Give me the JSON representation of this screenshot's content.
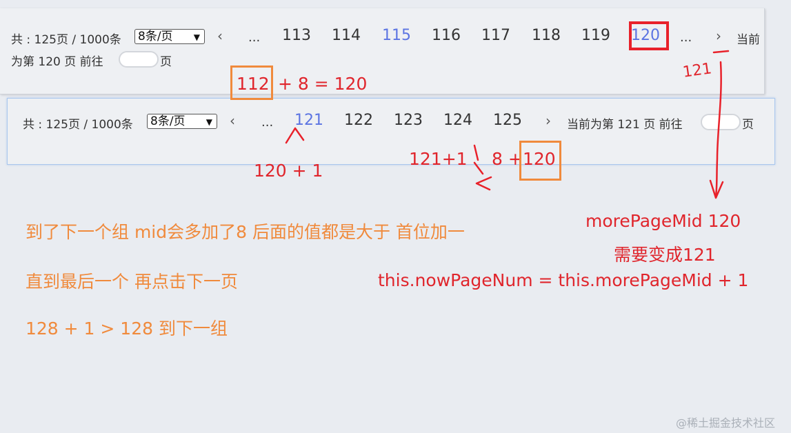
{
  "pager_top": {
    "total": "共 : 125页 / 1000条",
    "page_size": "8条/页",
    "prev": "‹",
    "ellipsis_left": "...",
    "pages": [
      "113",
      "114",
      "115",
      "116",
      "117",
      "118",
      "119",
      "120"
    ],
    "ellipsis_right": "...",
    "next": "›",
    "current_line1": "当前",
    "current_line2": "为第 120 页 前往",
    "page_suffix": "页"
  },
  "pager_bottom": {
    "total": "共 : 125页 / 1000条",
    "page_size": "8条/页",
    "prev": "‹",
    "ellipsis_left": "...",
    "pages": [
      "121",
      "122",
      "123",
      "124",
      "125"
    ],
    "next": "›",
    "current": "当前为第 121 页 前往",
    "page_suffix": "页"
  },
  "annotations": {
    "eq_112": "112",
    "eq_rest": "+ 8 = 120",
    "handwritten_121": "121",
    "plus_one": "120 + 1",
    "compare_left": "121+1",
    "compare_mid": "8 +",
    "compare_right": "120",
    "mid_note": "morePageMid  120",
    "change_note": "需要变成121",
    "code_note": "this.nowPageNum = this.morePageMid + 1",
    "orange_1": "到了下一个组 mid会多加了8  后面的值都是大于 首位加一",
    "orange_2": "直到最后一个  再点击下一页",
    "orange_3": "128 + 1 > 128  到下一组"
  },
  "watermark": "@稀土掘金技术社区",
  "colors": {
    "active_page": "#5b74e2",
    "annotation_red": "#e0252c",
    "annotation_orange": "#f08a3c",
    "highlight_box_red": "#e8212a",
    "highlight_box_orange": "#f08a3c"
  }
}
